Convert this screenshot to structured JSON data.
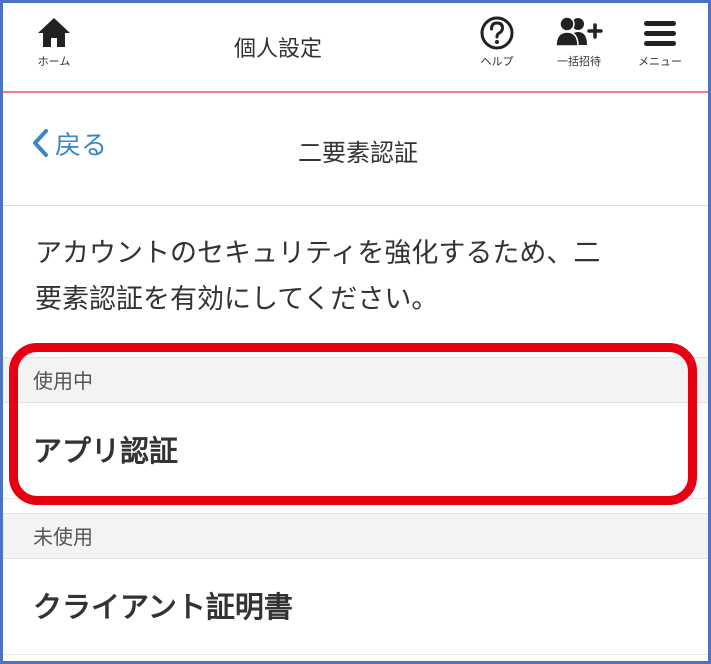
{
  "nav": {
    "home_label": "ホーム",
    "title": "個人設定",
    "help_label": "ヘルプ",
    "invite_label": "一括招待",
    "menu_label": "メニュー"
  },
  "subheader": {
    "back_label": "戻る",
    "title": "二要素認証"
  },
  "description": {
    "line1": "アカウントのセキュリティを強化するため、二",
    "line2": "要素認証を有効にしてください。"
  },
  "sections": {
    "active_header": "使用中",
    "active_item": "アプリ認証",
    "inactive_header": "未使用",
    "inactive_item": "クライアント証明書"
  },
  "colors": {
    "frame_border": "#4d72c4",
    "accent_line": "#ef7f86",
    "back_link": "#3a86c8",
    "highlight_box": "#e60012"
  },
  "icons": {
    "home": "home-icon",
    "help": "help-circle-icon",
    "invite": "add-users-icon",
    "menu": "hamburger-menu-icon",
    "back": "chevron-left-icon"
  }
}
